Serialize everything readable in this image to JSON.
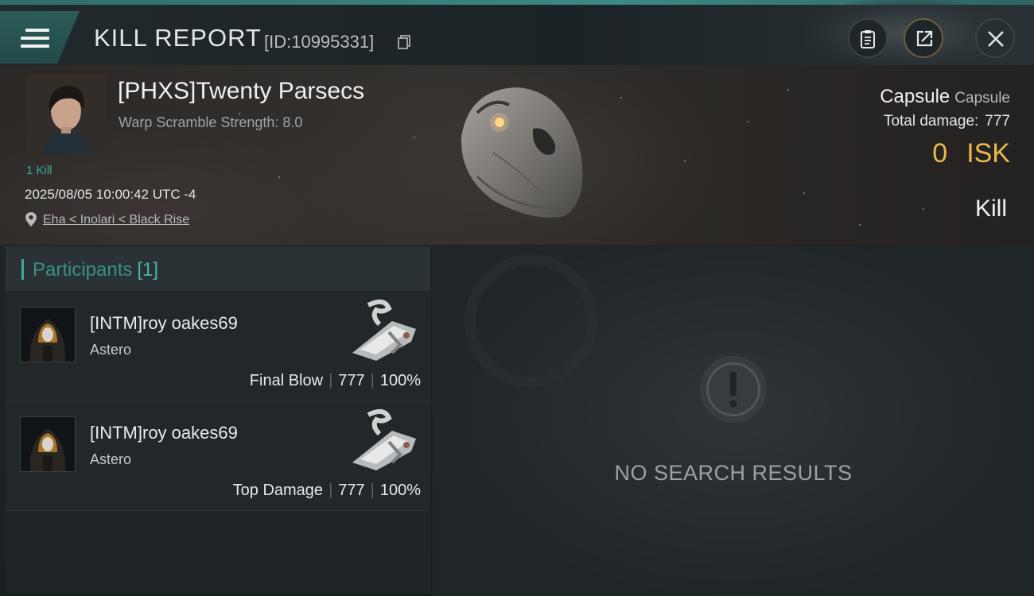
{
  "header": {
    "title": "KILL REPORT",
    "report_id": "[ID:10995331]"
  },
  "victim": {
    "name": "[PHXS]Twenty Parsecs",
    "warp_scramble": "Warp Scramble Strength: 8.0",
    "kills": "1 Kill",
    "datetime": "2025/08/05 10:00:42 UTC -4",
    "location": "Eha < Inolari < Black Rise",
    "ship_name": "Capsule",
    "ship_class": "Capsule",
    "total_damage_label": "Total damage:",
    "total_damage": "777",
    "isk_value": "0",
    "isk_unit": "ISK",
    "result": "Kill"
  },
  "participants": {
    "label": "Participants",
    "count": "[1]",
    "rows": [
      {
        "name": "[INTM]roy oakes69",
        "ship": "Astero",
        "role": "Final Blow",
        "damage": "777",
        "percent": "100%"
      },
      {
        "name": "[INTM]roy oakes69",
        "ship": "Astero",
        "role": "Top Damage",
        "damage": "777",
        "percent": "100%"
      }
    ]
  },
  "results": {
    "empty_text": "NO SEARCH RESULTS"
  },
  "icons": {
    "menu": "hamburger-icon",
    "copy": "copy-icon",
    "clipboard": "clipboard-icon",
    "share": "share-icon",
    "close": "close-icon",
    "location": "map-pin-icon",
    "no_results": "exclamation-icon"
  },
  "colors": {
    "accent_teal": "#3ea79b",
    "isk_gold": "#e9b94b"
  }
}
